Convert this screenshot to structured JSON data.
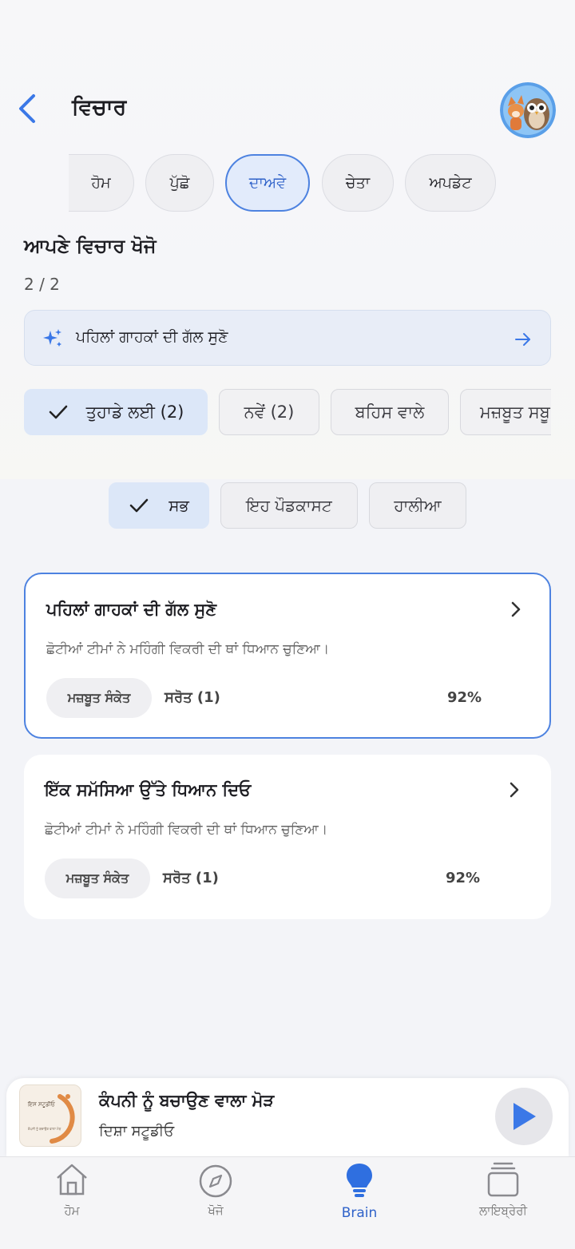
{
  "header": {
    "title": "ਵਿਚਾਰ"
  },
  "tabs": [
    {
      "label": "ਹੋਮ",
      "active": false
    },
    {
      "label": "ਪੁੱਛੋ",
      "active": false
    },
    {
      "label": "ਦਾਅਵੇ",
      "active": true
    },
    {
      "label": "ਚੇਤਾ",
      "active": false
    },
    {
      "label": "ਅਪਡੇਟ",
      "active": false
    }
  ],
  "section": {
    "title": "ਆਪਣੇ ਵਿਚਾਰ ਖੋਜੋ",
    "counter": "2 / 2"
  },
  "suggestion": {
    "text": "ਪਹਿਲਾਂ ਗਾਹਕਾਂ ਦੀ ਗੱਲ ਸੁਣੋ",
    "icon": "sparkle-icon"
  },
  "category_chips": [
    {
      "label": "ਤੁਹਾਡੇ ਲਈ (2)",
      "active": true
    },
    {
      "label": "ਨਵੇਂ (2)",
      "active": false
    },
    {
      "label": "ਬਹਿਸ ਵਾਲੇ",
      "active": false
    },
    {
      "label": "ਮਜ਼ਬੂਤ ਸਬੂ",
      "active": false
    }
  ],
  "scope_filters": [
    {
      "label": "ਸਭ",
      "active": true
    },
    {
      "label": "ਇਹ ਪੌਡਕਾਸਟ",
      "active": false
    },
    {
      "label": "ਹਾਲੀਆ",
      "active": false
    }
  ],
  "cards": [
    {
      "title": "ਪਹਿਲਾਂ ਗਾਹਕਾਂ ਦੀ ਗੱਲ ਸੁਣੋ",
      "description": "ਛੋਟੀਆਂ ਟੀਮਾਂ ਨੇ ਮਹਿੰਗੀ ਵਿਕਰੀ ਦੀ ਥਾਂ ਧਿਆਨ ਚੁਣਿਆ।",
      "badge": "ਮਜ਼ਬੂਤ ਸੰਕੇਤ",
      "sources": "ਸਰੋਤ (1)",
      "confidence": "92%",
      "selected": true
    },
    {
      "title": "ਇੱਕ ਸਮੱਸਿਆ ਉੱਤੇ ਧਿਆਨ ਦਿਓ",
      "description": "ਛੋਟੀਆਂ ਟੀਮਾਂ ਨੇ ਮਹਿੰਗੀ ਵਿਕਰੀ ਦੀ ਥਾਂ ਧਿਆਨ ਚੁਣਿਆ।",
      "badge": "ਮਜ਼ਬੂਤ ਸੰਕੇਤ",
      "sources": "ਸਰੋਤ (1)",
      "confidence": "92%",
      "selected": false
    }
  ],
  "player": {
    "title": "ਕੰਪਨੀ ਨੂੰ ਬਚਾਉਣ ਵਾਲਾ ਮੋੜ",
    "subtitle": "ਦਿਸ਼ਾ ਸਟੂਡੀਓ",
    "cover_text": "ਇਸ ਸਟੂਡੀਓ",
    "cover_subtext": "ਕੰਪਨੀ ਨੂੰ ਬਚਾਉਣ ਵਾਲਾ ਮੋੜ"
  },
  "nav": [
    {
      "label": "ਹੋਮ",
      "icon": "home-icon",
      "active": false
    },
    {
      "label": "ਖੋਜੋ",
      "icon": "compass-icon",
      "active": false
    },
    {
      "label": "Brain",
      "icon": "lightbulb-icon",
      "active": true
    },
    {
      "label": "ਲਾਇਬ੍ਰੇਰੀ",
      "icon": "library-icon",
      "active": false
    }
  ],
  "colors": {
    "accent": "#2f62c9",
    "accent_border": "#4d82e0",
    "chip_active_bg": "#dce7f8",
    "background": "#f3f4f8"
  }
}
